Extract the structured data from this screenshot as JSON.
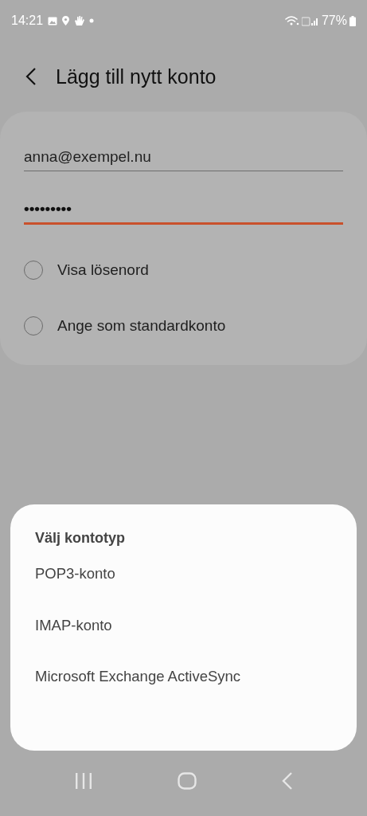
{
  "status_bar": {
    "time": "14:21",
    "battery": "77%"
  },
  "header": {
    "title": "Lägg till nytt konto"
  },
  "form": {
    "fields": [
      {
        "value": "anna@exempel.nu",
        "focused": false
      },
      {
        "value": "•••••••••",
        "focused": true
      }
    ],
    "options": [
      {
        "label": "Visa lösenord",
        "checked": false
      },
      {
        "label": "Ange som standardkonto",
        "checked": false
      }
    ]
  },
  "sheet": {
    "title": "Välj kontotyp",
    "items": [
      {
        "label": "POP3-konto"
      },
      {
        "label": "IMAP-konto"
      },
      {
        "label": "Microsoft Exchange ActiveSync"
      }
    ]
  }
}
